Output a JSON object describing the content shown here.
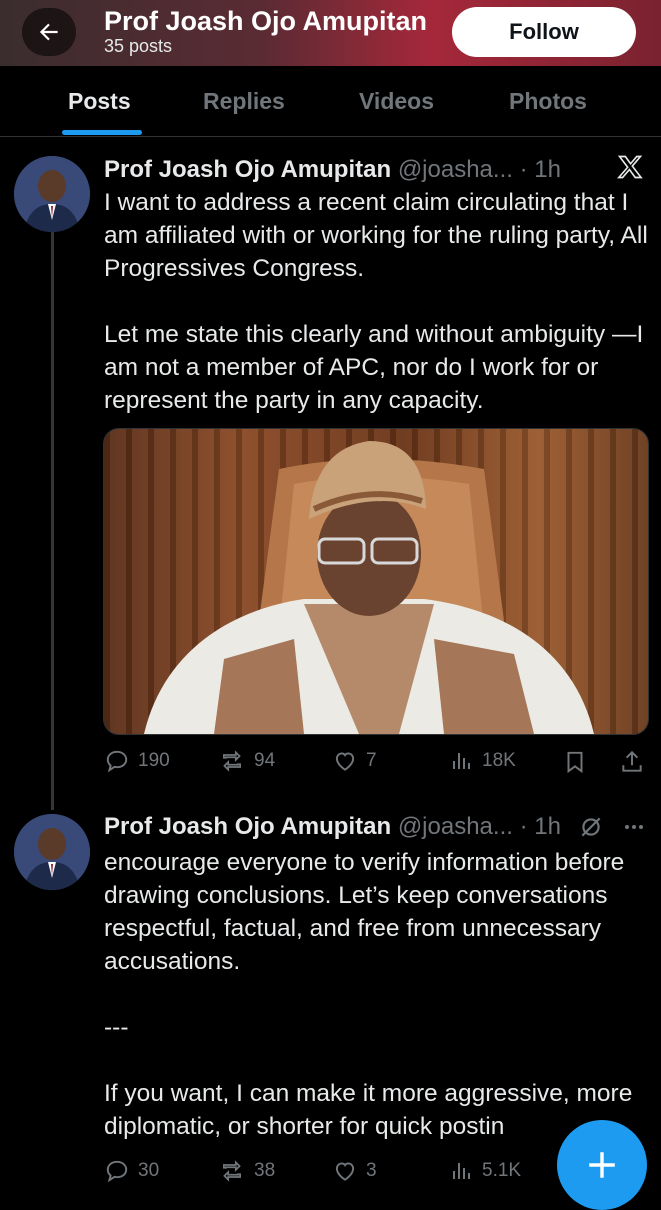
{
  "header": {
    "name": "Prof Joash Ojo Amupitan",
    "post_count": "35 posts",
    "follow_label": "Follow"
  },
  "tabs": [
    {
      "label": "Posts",
      "active": true
    },
    {
      "label": "Replies",
      "active": false
    },
    {
      "label": "Videos",
      "active": false
    },
    {
      "label": "Photos",
      "active": false
    }
  ],
  "posts": [
    {
      "author": "Prof Joash Ojo Amupitan",
      "meta": "@joasha... · 1h",
      "badge_icon": "x-logo-icon",
      "paragraphs": [
        "I want to address a recent claim circulating that I am affiliated with or working for the ruling party, All Progressives Congress.",
        "Let me state this clearly and without ambiguity —I am not a member of APC, nor do I work for or represent the party in any capacity."
      ],
      "has_image": true,
      "stats": {
        "replies": "190",
        "reposts": "94",
        "likes": "7",
        "views": "18K"
      }
    },
    {
      "author": "Prof Joash Ojo Amupitan",
      "meta": "@joasha... · 1h",
      "badge_icon": "grok-icon",
      "paragraphs": [
        "encourage everyone to verify information before drawing conclusions. Let’s keep conversations respectful, factual, and free from unnecessary accusations.",
        "---",
        "If you want, I can make it more aggressive, more diplomatic, or shorter for quick postin"
      ],
      "has_image": false,
      "stats": {
        "replies": "30",
        "reposts": "38",
        "likes": "3",
        "views": "5.1K"
      }
    }
  ],
  "colors": {
    "background": "#000000",
    "text": "#e7e9ea",
    "muted": "#71767b",
    "accent": "#1d9bf0"
  }
}
